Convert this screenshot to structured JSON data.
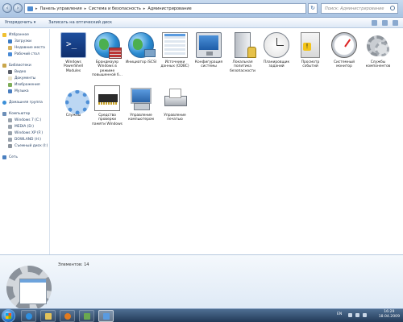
{
  "address": {
    "crumbs": [
      "Панель управления",
      "Система и безопасность",
      "Администрирование"
    ]
  },
  "search": {
    "placeholder": "Поиск: Администрирование"
  },
  "toolbar": {
    "organize": "Упорядочить ▾",
    "burn": "Записать на оптический диск"
  },
  "sidebar": {
    "favorites": {
      "title": "Избранное",
      "items": [
        "Загрузки",
        "Недавние места",
        "Рабочий стол"
      ]
    },
    "libraries": {
      "title": "Библиотеки",
      "items": [
        "Видео",
        "Документы",
        "Изображения",
        "Музыка"
      ]
    },
    "homegroup": "Домашняя группа",
    "computer": {
      "title": "Компьютер",
      "items": [
        "Windows 7 (C:)",
        "MEDIA (D:)",
        "Windows XP (F:)",
        "DOWLAND (H:)",
        "Съемный диск (I:)"
      ]
    },
    "network": "Сеть"
  },
  "tiles": [
    {
      "label": "Windows PowerShell Modules",
      "icon": "powershell-icon"
    },
    {
      "label": "Брандмауэр Windows в режиме повышенной б...",
      "icon": "firewall-globe-icon"
    },
    {
      "label": "Инициатор iSCSI",
      "icon": "iscsi-globe-icon"
    },
    {
      "label": "Источники данных (ODBC)",
      "icon": "odbc-icon"
    },
    {
      "label": "Конфигурация системы",
      "icon": "system-config-icon"
    },
    {
      "label": "Локальная политика безопасности",
      "icon": "security-policy-icon"
    },
    {
      "label": "Планировщик заданий",
      "icon": "task-scheduler-icon"
    },
    {
      "label": "Просмотр событий",
      "icon": "event-viewer-icon"
    },
    {
      "label": "Системный монитор",
      "icon": "performance-monitor-icon"
    },
    {
      "label": "Службы компонентов",
      "icon": "component-services-icon"
    },
    {
      "label": "Службы",
      "icon": "services-icon"
    },
    {
      "label": "Средство проверки памяти Windows",
      "icon": "memory-diagnostic-icon"
    },
    {
      "label": "Управление компьютером",
      "icon": "computer-management-icon"
    },
    {
      "label": "Управление печатью",
      "icon": "print-management-icon"
    }
  ],
  "details": {
    "count": "Элементов: 14"
  },
  "taskbar": {
    "lang": "EN",
    "time": "16:29",
    "date": "18.04.2009"
  },
  "colors": {
    "accent": "#2d7dd2",
    "taskbar": "#223a58",
    "sidebar_text": "#1e3a5f"
  }
}
